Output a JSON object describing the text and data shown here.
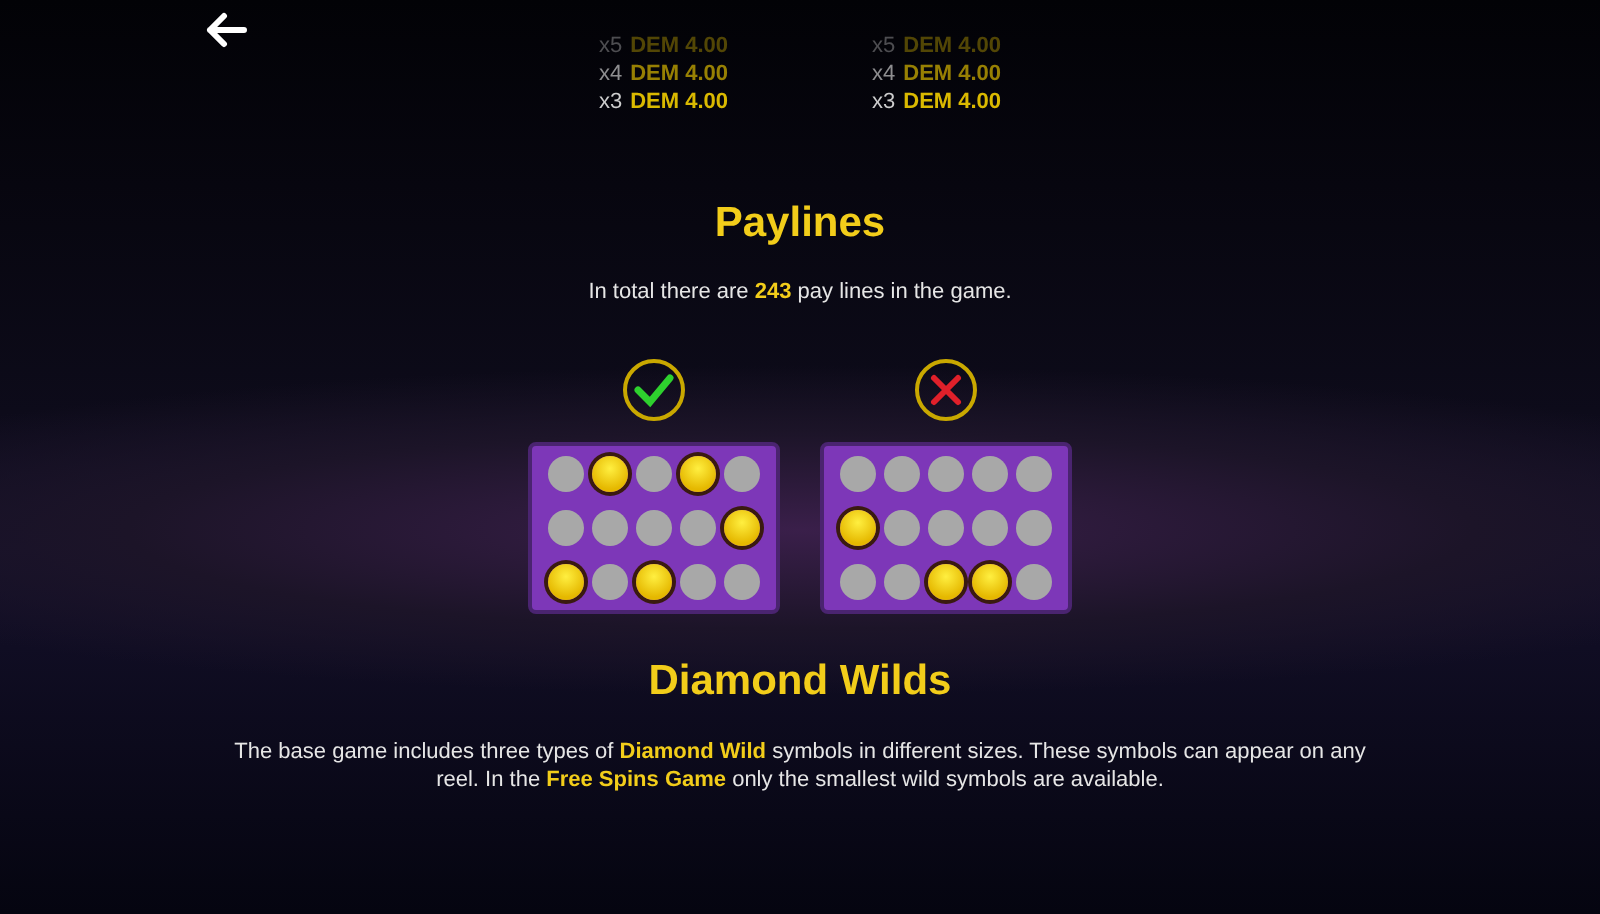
{
  "paytable": [
    {
      "entries": [
        {
          "count": "x5",
          "amount": "DEM 4.00"
        },
        {
          "count": "x4",
          "amount": "DEM 4.00"
        },
        {
          "count": "x3",
          "amount": "DEM 4.00"
        }
      ]
    },
    {
      "entries": [
        {
          "count": "x5",
          "amount": "DEM 4.00"
        },
        {
          "count": "x4",
          "amount": "DEM 4.00"
        },
        {
          "count": "x3",
          "amount": "DEM 4.00"
        }
      ]
    }
  ],
  "sections": [
    {
      "title": "Paylines",
      "text": "In total there are **243** pay lines in the game.",
      "examples": [
        {
          "kind": "valid",
          "rows": [
            [
              false,
              true,
              false,
              true,
              false
            ],
            [
              false,
              false,
              false,
              false,
              true
            ],
            [
              true,
              false,
              true,
              false,
              false
            ]
          ]
        },
        {
          "kind": "invalid",
          "rows": [
            [
              false,
              false,
              false,
              false,
              false
            ],
            [
              true,
              false,
              false,
              false,
              false
            ],
            [
              false,
              false,
              true,
              true,
              false
            ]
          ]
        }
      ]
    },
    {
      "title": "Diamond Wilds",
      "text": "The base game includes three types of **Diamond Wild** symbols in different sizes. These symbols can appear on any reel. In the **Free Spins Game** only the smallest wild symbols are available."
    }
  ]
}
